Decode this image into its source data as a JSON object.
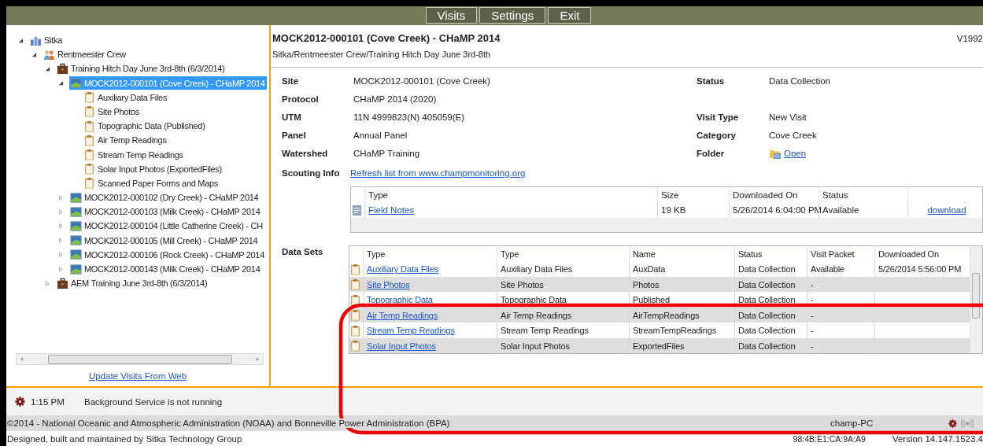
{
  "toolbar": {
    "buttons": [
      "Visits",
      "Settings",
      "Exit"
    ]
  },
  "tree": {
    "items": [
      {
        "label": "Sitka",
        "kind": "org",
        "expanded": true,
        "selected": false,
        "children": [
          {
            "label": "Rentmeester Crew",
            "kind": "crew",
            "expanded": true,
            "selected": false,
            "children": [
              {
                "label": "Training Hitch Day June 3rd-8th (6/3/2014)",
                "kind": "trip",
                "expanded": true,
                "selected": false,
                "children": [
                  {
                    "label": "MOCK2012-000101 (Cove Creek) - CHaMP 2014",
                    "kind": "visit",
                    "expanded": true,
                    "selected": true,
                    "children": [
                      {
                        "label": "Auxiliary Data Files",
                        "kind": "dataset",
                        "selected": false
                      },
                      {
                        "label": "Site Photos",
                        "kind": "dataset",
                        "selected": false
                      },
                      {
                        "label": "Topographic Data (Published)",
                        "kind": "dataset",
                        "selected": false
                      },
                      {
                        "label": "Air Temp Readings",
                        "kind": "dataset",
                        "selected": false
                      },
                      {
                        "label": "Stream Temp Readings",
                        "kind": "dataset",
                        "selected": false
                      },
                      {
                        "label": "Solar Input Photos (ExportedFiles)",
                        "kind": "dataset",
                        "selected": false
                      },
                      {
                        "label": "Scanned Paper Forms and Maps",
                        "kind": "dataset",
                        "selected": false
                      }
                    ]
                  },
                  {
                    "label": "MOCK2012-000102 (Dry Creek) - CHaMP 2014",
                    "kind": "visit",
                    "expanded": false,
                    "selected": false
                  },
                  {
                    "label": "MOCK2012-000103 (Milk Creek) - CHaMP 2014",
                    "kind": "visit",
                    "expanded": false,
                    "selected": false
                  },
                  {
                    "label": "MOCK2012-000104 (Little Catherine Creek) - CH",
                    "kind": "visit",
                    "expanded": false,
                    "selected": false
                  },
                  {
                    "label": "MOCK2012-000105 (Mill Creek) - CHaMP 2014",
                    "kind": "visit",
                    "expanded": false,
                    "selected": false
                  },
                  {
                    "label": "MOCK2012-000106 (Rock Creek) - CHaMP 2014",
                    "kind": "visit",
                    "expanded": false,
                    "selected": false
                  },
                  {
                    "label": "MOCK2012-000143 (Milk Creek) - CHaMP 2014",
                    "kind": "visit",
                    "expanded": false,
                    "selected": false
                  }
                ]
              },
              {
                "label": "AEM Training June 3rd-8th (6/3/2014)",
                "kind": "trip",
                "expanded": false,
                "selected": false
              }
            ]
          }
        ]
      }
    ]
  },
  "update_link": "Update Visits From Web",
  "visit": {
    "title": "MOCK2012-000101 (Cove Creek) - CHaMP 2014",
    "path": "Sitka/Rentmeester Crew/Training Hitch Day June 3rd-8th",
    "version": "V1992",
    "fields": [
      {
        "label": "Site",
        "value": "MOCK2012-000101 (Cove Creek)",
        "right": {
          "label": "Status",
          "value": "Data Collection",
          "kind": "text"
        }
      },
      {
        "label": "Protocol",
        "value": "CHaMP 2014 (2020)"
      },
      {
        "label": "UTM",
        "value": "11N 4999823(N) 405059(E)",
        "right": {
          "label": "Visit Type",
          "value": "New Visit",
          "kind": "text"
        }
      },
      {
        "label": "Panel",
        "value": "Annual Panel",
        "right": {
          "label": "Category",
          "value": "Cove Creek",
          "kind": "text"
        }
      },
      {
        "label": "Watershed",
        "value": "CHaMP Training",
        "right": {
          "label": "Folder",
          "value": "Open",
          "kind": "link"
        }
      }
    ],
    "scouting": {
      "label": "Scouting Info",
      "link": "Refresh list from www.champmonitoring.org"
    }
  },
  "field_notes": {
    "columns": [
      "Type",
      "Size",
      "Downloaded On",
      "Status"
    ],
    "rows": [
      {
        "type": "Field Notes",
        "size": "19 KB",
        "downloaded_on": "5/26/2014 6:04:00 PM",
        "status": "Available",
        "action": "download"
      }
    ]
  },
  "datasets": {
    "label": "Data Sets",
    "columns": [
      "Type",
      "Type",
      "Name",
      "Status",
      "Visit Packet",
      "Downloaded On"
    ],
    "rows": [
      {
        "link": "Auxiliary Data Files",
        "type": "Auxiliary Data Files",
        "name": "AuxData",
        "status": "Data Collection",
        "visit_packet": "Available",
        "downloaded_on": "5/26/2014 5:56:00 PM"
      },
      {
        "link": "Site Photos",
        "type": "Site Photos",
        "name": "Photos",
        "status": "Data Collection",
        "visit_packet": "-"
      },
      {
        "link": "Topographic Data",
        "type": "Topographic Data",
        "name": "Published",
        "status": "Data Collection",
        "visit_packet": "-"
      },
      {
        "link": "Air Temp Readings",
        "type": "Air Temp Readings",
        "name": "AirTempReadings",
        "status": "Data Collection",
        "visit_packet": "-"
      },
      {
        "link": "Stream Temp Readings",
        "type": "Stream Temp Readings",
        "name": "StreamTempReadings",
        "status": "Data Collection",
        "visit_packet": "-"
      },
      {
        "link": "Solar Input Photos",
        "type": "Solar Input Photos",
        "name": "ExportedFiles",
        "status": "Data Collection",
        "visit_packet": "-"
      }
    ]
  },
  "status": {
    "time": "1:15 PM",
    "message": "Background Service is not running"
  },
  "footer": {
    "copyright": "©2014 - National Oceanic and Atmospheric Administration (NOAA) and Bonneville Power Administration (BPA)",
    "machine": "champ-PC",
    "credit": "Designed, built and maintained by Sitka Technology Group",
    "mac": "98:4B:E1:CA:9A:A9",
    "version": "Version 14.147.1523.4"
  }
}
